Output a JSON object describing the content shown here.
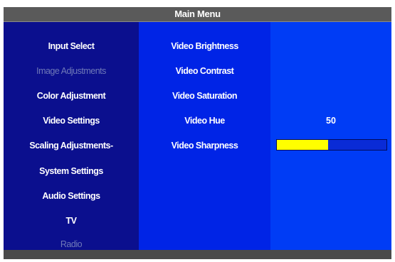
{
  "title": "Main Menu",
  "menu": [
    {
      "label": "Input Select",
      "state": "normal"
    },
    {
      "label": "Image Adjustments",
      "state": "disabled"
    },
    {
      "label": "Color Adjustment",
      "state": "normal"
    },
    {
      "label": "Video Settings",
      "state": "active"
    },
    {
      "label": "Scaling Adjustments-",
      "state": "normal"
    },
    {
      "label": "System Settings",
      "state": "normal"
    },
    {
      "label": "Audio Settings",
      "state": "normal"
    },
    {
      "label": "TV",
      "state": "normal"
    },
    {
      "label": "Radio",
      "state": "disabled"
    }
  ],
  "params": [
    {
      "label": "Video Brightness"
    },
    {
      "label": "Video Contrast"
    },
    {
      "label": "Video Saturation"
    },
    {
      "label": "Video Hue",
      "value": "50"
    },
    {
      "label": "Video Sharpness",
      "level": 0.47
    }
  ],
  "colors": {
    "left_bg": "#0b0f8e",
    "mid_bg": "#0024e6",
    "right_bg": "#003cf5",
    "bar_fill": "#ffff00"
  }
}
